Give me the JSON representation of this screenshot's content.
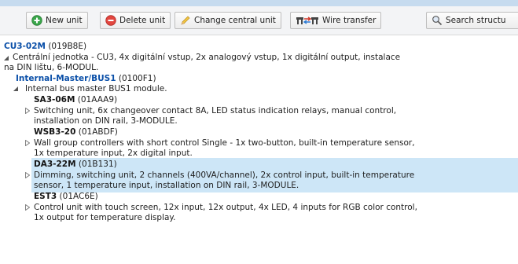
{
  "toolbar": {
    "new_unit": "New unit",
    "delete_unit": "Delete unit",
    "change_central_unit": "Change central unit",
    "wire_transfer": "Wire transfer",
    "search_structure": "Search structu"
  },
  "tree": {
    "root": {
      "code": "CU3-02M",
      "id": "(019B8E)",
      "desc_line1": "Centrální jednotka - CU3, 4x digitální vstup, 2x analogový vstup, 1x digitální output, instalace",
      "desc_line2": "na DIN lištu, 6-MODUL."
    },
    "bus": {
      "code": "Internal-Master/BUS1",
      "id": "(0100F1)",
      "desc": "Internal bus master BUS1 module."
    },
    "units": [
      {
        "code": "SA3-06M",
        "id": "(01AAA9)",
        "desc_line1": "Switching unit, 6x changeover contact 8A, LED status indication relays, manual control,",
        "desc_line2": "installation on DIN rail, 3-MODULE."
      },
      {
        "code": "WSB3-20",
        "id": "(01ABDF)",
        "desc_line1": "Wall group controllers with short control Single - 1x two-button, built-in temperature sensor,",
        "desc_line2": "1x temperature input, 2x digital input."
      },
      {
        "code": "DA3-22M",
        "id": "(01B131)",
        "desc_line1": "Dimming, switching unit, 2 channels (400VA/channel), 2x control input, built-in temperature",
        "desc_line2": "sensor, 1 temperature input, installation on DIN rail, 3-MODULE."
      },
      {
        "code": "EST3",
        "id": "(01AC6E)",
        "desc_line1": "Control unit with touch screen, 12x input, 12x output, 4x LED, 4 inputs for RGB color control,",
        "desc_line2": "1x output for temperature display."
      }
    ]
  },
  "colors": {
    "accent": "#0a4fa8",
    "selection": "#cde6f7",
    "toolbar_bg": "#f3f4f6"
  }
}
